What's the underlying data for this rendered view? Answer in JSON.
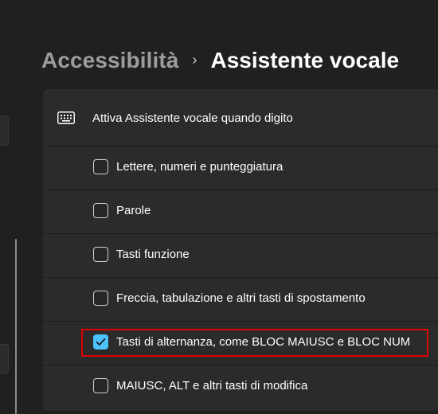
{
  "breadcrumb": {
    "parent": "Accessibilità",
    "separator": "›",
    "current": "Assistente vocale"
  },
  "section": {
    "icon": "keyboard-icon",
    "title": "Attiva Assistente vocale quando digito"
  },
  "options": [
    {
      "label": "Lettere, numeri e punteggiatura",
      "checked": false
    },
    {
      "label": "Parole",
      "checked": false
    },
    {
      "label": "Tasti funzione",
      "checked": false
    },
    {
      "label": "Freccia, tabulazione e altri tasti di spostamento",
      "checked": false
    },
    {
      "label": "Tasti di alternanza, come BLOC MAIUSC e BLOC NUM",
      "checked": true
    },
    {
      "label": "MAIUSC, ALT e altri tasti di modifica",
      "checked": false
    }
  ],
  "colors": {
    "accent": "#4cc2ff",
    "highlight": "#e00000",
    "background": "#202020",
    "card": "#2b2b2b"
  }
}
